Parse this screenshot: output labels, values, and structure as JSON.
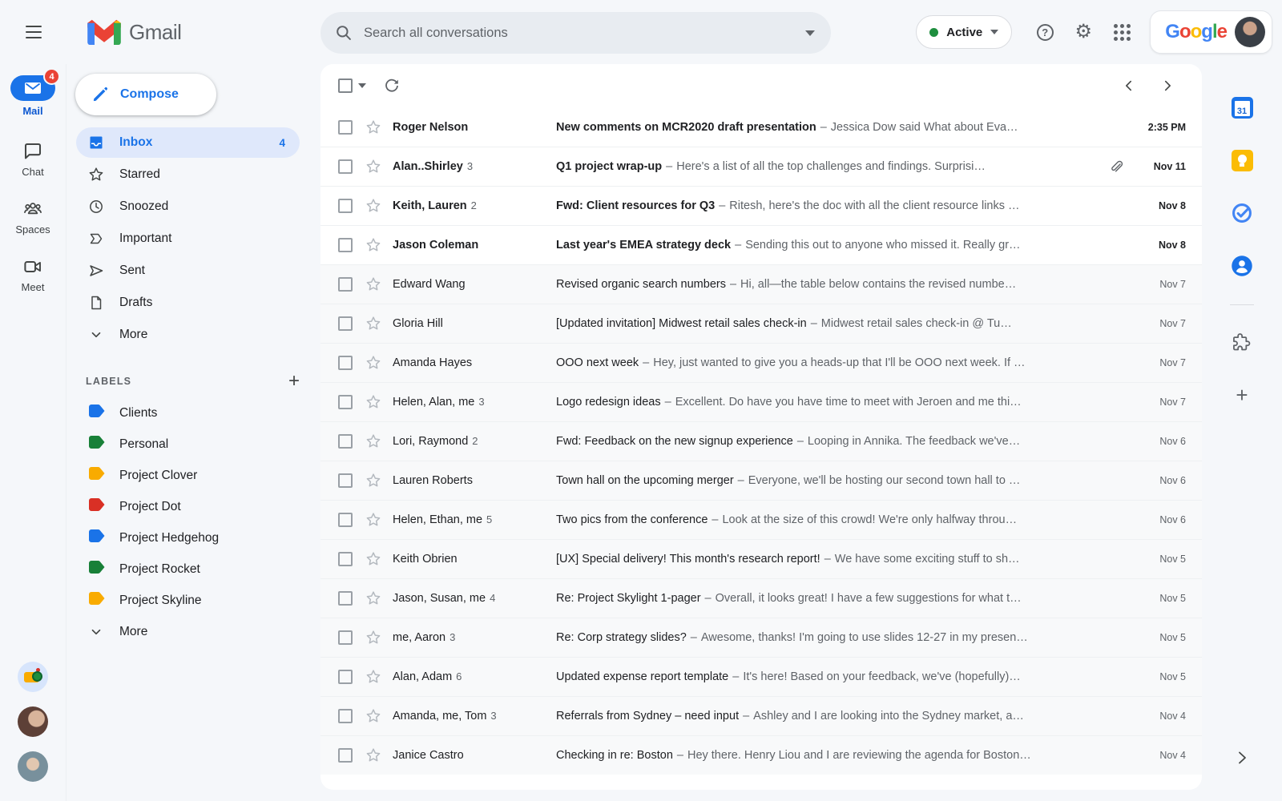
{
  "header": {
    "app_name": "Gmail",
    "search": {
      "placeholder": "Search all conversations"
    },
    "status": {
      "label": "Active"
    },
    "brand": {
      "letters": [
        {
          "ch": "G",
          "color": "#4285F4"
        },
        {
          "ch": "o",
          "color": "#EA4335"
        },
        {
          "ch": "o",
          "color": "#FBBC05"
        },
        {
          "ch": "g",
          "color": "#4285F4"
        },
        {
          "ch": "l",
          "color": "#34A853"
        },
        {
          "ch": "e",
          "color": "#EA4335"
        }
      ]
    }
  },
  "rail": {
    "items": [
      {
        "label": "Mail",
        "badge": "4"
      },
      {
        "label": "Chat"
      },
      {
        "label": "Spaces"
      },
      {
        "label": "Meet"
      }
    ]
  },
  "sidebar": {
    "compose_label": "Compose",
    "items": [
      {
        "label": "Inbox",
        "count": "4"
      },
      {
        "label": "Starred"
      },
      {
        "label": "Snoozed"
      },
      {
        "label": "Important"
      },
      {
        "label": "Sent"
      },
      {
        "label": "Drafts"
      },
      {
        "label": "More"
      }
    ],
    "labels_header": "LABELS",
    "labels": [
      {
        "name": "Clients",
        "color": "#1a73e8"
      },
      {
        "name": "Personal",
        "color": "#188038"
      },
      {
        "name": "Project Clover",
        "color": "#f9ab00"
      },
      {
        "name": "Project Dot",
        "color": "#d93025"
      },
      {
        "name": "Project Hedgehog",
        "color": "#1a73e8"
      },
      {
        "name": "Project Rocket",
        "color": "#188038"
      },
      {
        "name": "Project Skyline",
        "color": "#f9ab00"
      }
    ],
    "labels_more": "More"
  },
  "mail": {
    "separator": "–",
    "rows": [
      {
        "sender": "Roger Nelson",
        "subject": "New comments on MCR2020 draft presentation",
        "snippet": "Jessica Dow said What about Eva…",
        "date": "2:35 PM",
        "unread": true
      },
      {
        "sender": "Alan..Shirley",
        "count": "3",
        "subject": "Q1 project wrap-up",
        "snippet": "Here's a list of all the top challenges and findings. Surprisi…",
        "date": "Nov 11",
        "unread": true,
        "attachment": true
      },
      {
        "sender": "Keith, Lauren",
        "count": "2",
        "subject": "Fwd: Client resources for Q3",
        "snippet": "Ritesh, here's the doc with all the client resource links …",
        "date": "Nov 8",
        "unread": true
      },
      {
        "sender": "Jason Coleman",
        "subject": "Last year's EMEA strategy deck",
        "snippet": "Sending this out to anyone who missed it. Really gr…",
        "date": "Nov 8",
        "unread": true
      },
      {
        "sender": "Edward Wang",
        "subject": "Revised organic search numbers",
        "snippet": "Hi, all—the table below contains the revised numbe…",
        "date": "Nov 7",
        "unread": false
      },
      {
        "sender": "Gloria Hill",
        "subject": "[Updated invitation] Midwest retail sales check-in",
        "snippet": "Midwest retail sales check-in @ Tu…",
        "date": "Nov 7",
        "unread": false
      },
      {
        "sender": "Amanda Hayes",
        "subject": "OOO next week",
        "snippet": "Hey, just wanted to give you a heads-up that I'll be OOO next week. If …",
        "date": "Nov 7",
        "unread": false
      },
      {
        "sender": "Helen, Alan, me",
        "count": "3",
        "subject": "Logo redesign ideas",
        "snippet": "Excellent. Do have you have time to meet with Jeroen and me thi…",
        "date": "Nov 7",
        "unread": false
      },
      {
        "sender": "Lori, Raymond",
        "count": "2",
        "subject": "Fwd: Feedback on the new signup experience",
        "snippet": "Looping in Annika. The feedback we've…",
        "date": "Nov 6",
        "unread": false
      },
      {
        "sender": "Lauren Roberts",
        "subject": "Town hall on the upcoming merger",
        "snippet": "Everyone, we'll be hosting our second town hall to …",
        "date": "Nov 6",
        "unread": false
      },
      {
        "sender": "Helen, Ethan, me",
        "count": "5",
        "subject": "Two pics from the conference",
        "snippet": "Look at the size of this crowd! We're only halfway throu…",
        "date": "Nov 6",
        "unread": false
      },
      {
        "sender": "Keith Obrien",
        "subject": "[UX] Special delivery! This month's research report!",
        "snippet": "We have some exciting stuff to sh…",
        "date": "Nov 5",
        "unread": false
      },
      {
        "sender": "Jason, Susan, me",
        "count": "4",
        "subject": "Re: Project Skylight 1-pager",
        "snippet": "Overall, it looks great! I have a few suggestions for what t…",
        "date": "Nov 5",
        "unread": false
      },
      {
        "sender": "me, Aaron",
        "count": "3",
        "subject": "Re: Corp strategy slides?",
        "snippet": "Awesome, thanks! I'm going to use slides 12-27 in my presen…",
        "date": "Nov 5",
        "unread": false
      },
      {
        "sender": "Alan, Adam",
        "count": "6",
        "subject": "Updated expense report template",
        "snippet": "It's here! Based on your feedback, we've (hopefully)…",
        "date": "Nov 5",
        "unread": false
      },
      {
        "sender": "Amanda, me, Tom",
        "count": "3",
        "subject": "Referrals from Sydney – need input",
        "snippet": "Ashley and I are looking into the Sydney market, a…",
        "date": "Nov 4",
        "unread": false
      },
      {
        "sender": "Janice Castro",
        "subject": "Checking in re: Boston",
        "snippet": "Hey there. Henry Liou and I are reviewing the agenda for Boston…",
        "date": "Nov 4",
        "unread": false
      }
    ]
  },
  "right_panel": {
    "icons": [
      "calendar",
      "keep",
      "tasks",
      "contacts",
      "addons",
      "add"
    ]
  }
}
